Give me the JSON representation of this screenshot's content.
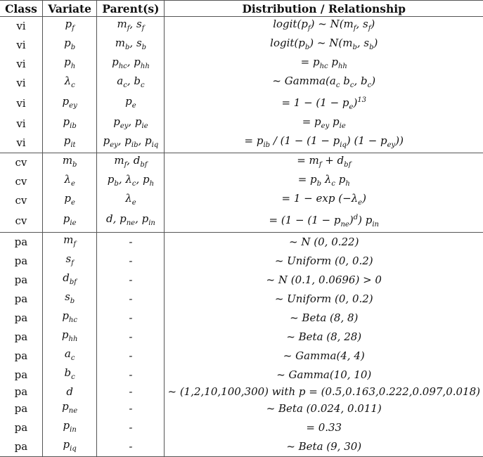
{
  "table": {
    "headers": [
      "Class",
      "Variate",
      "Parent(s)",
      "Distribution / Relationship"
    ],
    "sections": [
      {
        "class": "vi",
        "rows": [
          {
            "class": "vi",
            "variate": "p_f",
            "parents": "m_f, s_f",
            "relationship": "logit(p_f) ~ N(m_f, s_f)"
          },
          {
            "class": "vi",
            "variate": "p_b",
            "parents": "m_b, s_b",
            "relationship": "logit(p_b) ~ N(m_b, s_b)"
          },
          {
            "class": "vi",
            "variate": "p_h",
            "parents": "p_hc, p_hh",
            "relationship": "= p_hc p_hh"
          },
          {
            "class": "vi",
            "variate": "λ_c",
            "parents": "a_c, b_c",
            "relationship": "~ Gamma(a_c b_c, b_c)"
          },
          {
            "class": "vi",
            "variate": "p_ey",
            "parents": "p_e",
            "relationship": "= 1 − (1 − p_e)^13"
          },
          {
            "class": "vi",
            "variate": "p_ib",
            "parents": "p_ey, p_ie",
            "relationship": "= p_ey p_ie"
          },
          {
            "class": "vi",
            "variate": "p_it",
            "parents": "p_ey, p_ib, p_iq",
            "relationship": "= p_ib / (1 − (1 − p_iq) (1 − p_ey))"
          }
        ]
      },
      {
        "class": "cv",
        "rows": [
          {
            "class": "cv",
            "variate": "m_b",
            "parents": "m_f, d_bf",
            "relationship": "= m_f + d_bf"
          },
          {
            "class": "cv",
            "variate": "λ_e",
            "parents": "p_b, λ_c, p_h",
            "relationship": "= p_b λ_c p_h"
          },
          {
            "class": "cv",
            "variate": "p_e",
            "parents": "λ_e",
            "relationship": "= 1 − exp (−λ_e)"
          },
          {
            "class": "cv",
            "variate": "p_ie",
            "parents": "d, p_ne, p_in",
            "relationship": "= (1 − (1 − p_ne)^d) p_in"
          }
        ]
      },
      {
        "class": "pa",
        "rows": [
          {
            "class": "pa",
            "variate": "m_f",
            "parents": "-",
            "relationship": "~ N (0, 0.22)"
          },
          {
            "class": "pa",
            "variate": "s_f",
            "parents": "-",
            "relationship": "~ Uniform (0, 0.2)"
          },
          {
            "class": "pa",
            "variate": "d_bf",
            "parents": "-",
            "relationship": "~ N (0.1, 0.0696)  >  0"
          },
          {
            "class": "pa",
            "variate": "s_b",
            "parents": "-",
            "relationship": "~ Uniform (0, 0.2)"
          },
          {
            "class": "pa",
            "variate": "p_hc",
            "parents": "-",
            "relationship": "~ Beta (8, 8)"
          },
          {
            "class": "pa",
            "variate": "p_hh",
            "parents": "-",
            "relationship": "~ Beta (8, 28)"
          },
          {
            "class": "pa",
            "variate": "a_c",
            "parents": "-",
            "relationship": "~ Gamma(4, 4)"
          },
          {
            "class": "pa",
            "variate": "b_c",
            "parents": "-",
            "relationship": "~ Gamma(10, 10)"
          },
          {
            "class": "pa",
            "variate": "d",
            "parents": "-",
            "relationship": "~ (1,2,10,100,300) with p = (0.5,0.163,0.222,0.097,0.018)"
          },
          {
            "class": "pa",
            "variate": "p_ne",
            "parents": "-",
            "relationship": "~ Beta (0.024, 0.011)"
          },
          {
            "class": "pa",
            "variate": "p_in",
            "parents": "-",
            "relationship": "= 0.33"
          },
          {
            "class": "pa",
            "variate": "p_iq",
            "parents": "-",
            "relationship": "~ Beta (9, 30)"
          }
        ]
      }
    ]
  }
}
